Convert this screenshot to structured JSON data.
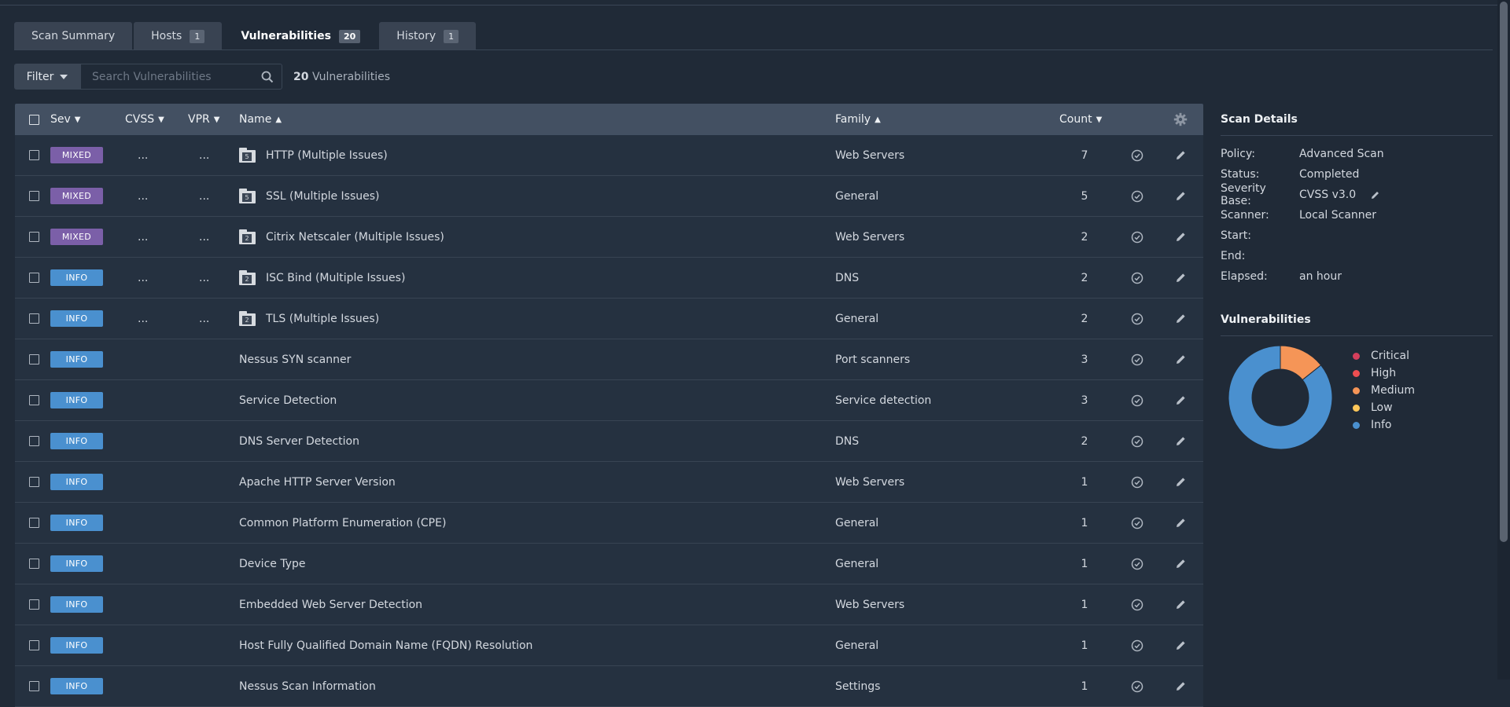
{
  "tabs": [
    {
      "label": "Scan Summary",
      "badge": ""
    },
    {
      "label": "Hosts",
      "badge": "1"
    },
    {
      "label": "Vulnerabilities",
      "badge": "20"
    },
    {
      "label": "History",
      "badge": "1"
    }
  ],
  "filter": {
    "label": "Filter",
    "placeholder": "Search Vulnerabilities",
    "count": "20",
    "count_suffix": "Vulnerabilities"
  },
  "table": {
    "headers": {
      "sev": "Sev",
      "cvss": "CVSS",
      "vpr": "VPR",
      "name": "Name",
      "family": "Family",
      "count": "Count"
    },
    "rows": [
      {
        "sev": "MIXED",
        "cvss": "...",
        "vpr": "...",
        "folder": "5",
        "name": "HTTP (Multiple Issues)",
        "family": "Web Servers",
        "count": "7"
      },
      {
        "sev": "MIXED",
        "cvss": "...",
        "vpr": "...",
        "folder": "5",
        "name": "SSL (Multiple Issues)",
        "family": "General",
        "count": "5"
      },
      {
        "sev": "MIXED",
        "cvss": "...",
        "vpr": "...",
        "folder": "2",
        "name": "Citrix Netscaler (Multiple Issues)",
        "family": "Web Servers",
        "count": "2"
      },
      {
        "sev": "INFO",
        "cvss": "...",
        "vpr": "...",
        "folder": "2",
        "name": "ISC Bind (Multiple Issues)",
        "family": "DNS",
        "count": "2"
      },
      {
        "sev": "INFO",
        "cvss": "...",
        "vpr": "...",
        "folder": "2",
        "name": "TLS (Multiple Issues)",
        "family": "General",
        "count": "2"
      },
      {
        "sev": "INFO",
        "cvss": "",
        "vpr": "",
        "folder": "",
        "name": "Nessus SYN scanner",
        "family": "Port scanners",
        "count": "3"
      },
      {
        "sev": "INFO",
        "cvss": "",
        "vpr": "",
        "folder": "",
        "name": "Service Detection",
        "family": "Service detection",
        "count": "3"
      },
      {
        "sev": "INFO",
        "cvss": "",
        "vpr": "",
        "folder": "",
        "name": "DNS Server Detection",
        "family": "DNS",
        "count": "2"
      },
      {
        "sev": "INFO",
        "cvss": "",
        "vpr": "",
        "folder": "",
        "name": "Apache HTTP Server Version",
        "family": "Web Servers",
        "count": "1"
      },
      {
        "sev": "INFO",
        "cvss": "",
        "vpr": "",
        "folder": "",
        "name": "Common Platform Enumeration (CPE)",
        "family": "General",
        "count": "1"
      },
      {
        "sev": "INFO",
        "cvss": "",
        "vpr": "",
        "folder": "",
        "name": "Device Type",
        "family": "General",
        "count": "1"
      },
      {
        "sev": "INFO",
        "cvss": "",
        "vpr": "",
        "folder": "",
        "name": "Embedded Web Server Detection",
        "family": "Web Servers",
        "count": "1"
      },
      {
        "sev": "INFO",
        "cvss": "",
        "vpr": "",
        "folder": "",
        "name": "Host Fully Qualified Domain Name (FQDN) Resolution",
        "family": "General",
        "count": "1"
      },
      {
        "sev": "INFO",
        "cvss": "",
        "vpr": "",
        "folder": "",
        "name": "Nessus Scan Information",
        "family": "Settings",
        "count": "1"
      }
    ]
  },
  "scan_details": {
    "title": "Scan Details",
    "items": [
      {
        "key": "Policy:",
        "value": "Advanced Scan"
      },
      {
        "key": "Status:",
        "value": "Completed"
      },
      {
        "key": "Severity Base:",
        "value": "CVSS v3.0"
      },
      {
        "key": "Scanner:",
        "value": "Local Scanner"
      },
      {
        "key": "Start:",
        "value": ""
      },
      {
        "key": "End:",
        "value": ""
      },
      {
        "key": "Elapsed:",
        "value": "an hour"
      }
    ]
  },
  "vulnerabilities": {
    "title": "Vulnerabilities",
    "legend": [
      {
        "label": "Critical",
        "color": "#d43f5c"
      },
      {
        "label": "High",
        "color": "#ee4e51"
      },
      {
        "label": "Medium",
        "color": "#f59557"
      },
      {
        "label": "Low",
        "color": "#fdc75a"
      },
      {
        "label": "Info",
        "color": "#4a90cf"
      }
    ],
    "chart_data": {
      "type": "pie",
      "categories": [
        "Critical",
        "High",
        "Medium",
        "Low",
        "Info"
      ],
      "values": [
        0,
        0,
        1,
        0,
        6
      ]
    }
  }
}
